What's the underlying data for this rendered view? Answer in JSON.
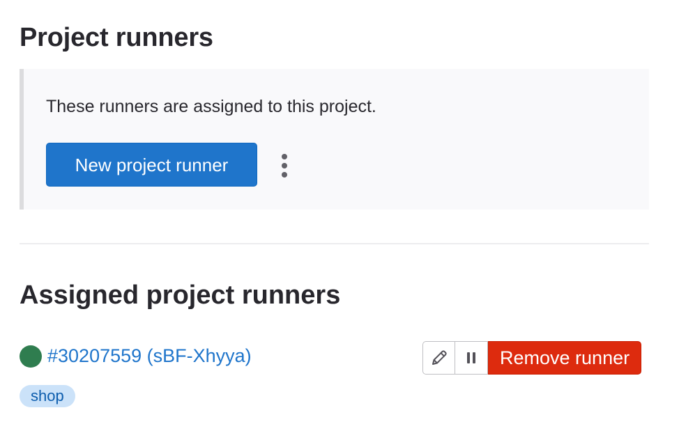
{
  "project_runners": {
    "title": "Project runners",
    "description": "These runners are assigned to this project.",
    "new_runner_label": "New project runner",
    "more_actions_icon": "vertical-ellipsis-icon"
  },
  "assigned_runners": {
    "title": "Assigned project runners",
    "runners": [
      {
        "status_color": "#2f7d4f",
        "status": "online",
        "link_text": "#30207559 (sBF-Xhyya)",
        "tags": [
          "shop"
        ],
        "actions": {
          "edit_icon": "pencil-icon",
          "pause_icon": "pause-icon",
          "remove_label": "Remove runner"
        }
      }
    ]
  },
  "colors": {
    "primary": "#1f75cb",
    "danger": "#dd2b0e",
    "success": "#2f7d4f",
    "tag_background": "#cbe2f9"
  }
}
